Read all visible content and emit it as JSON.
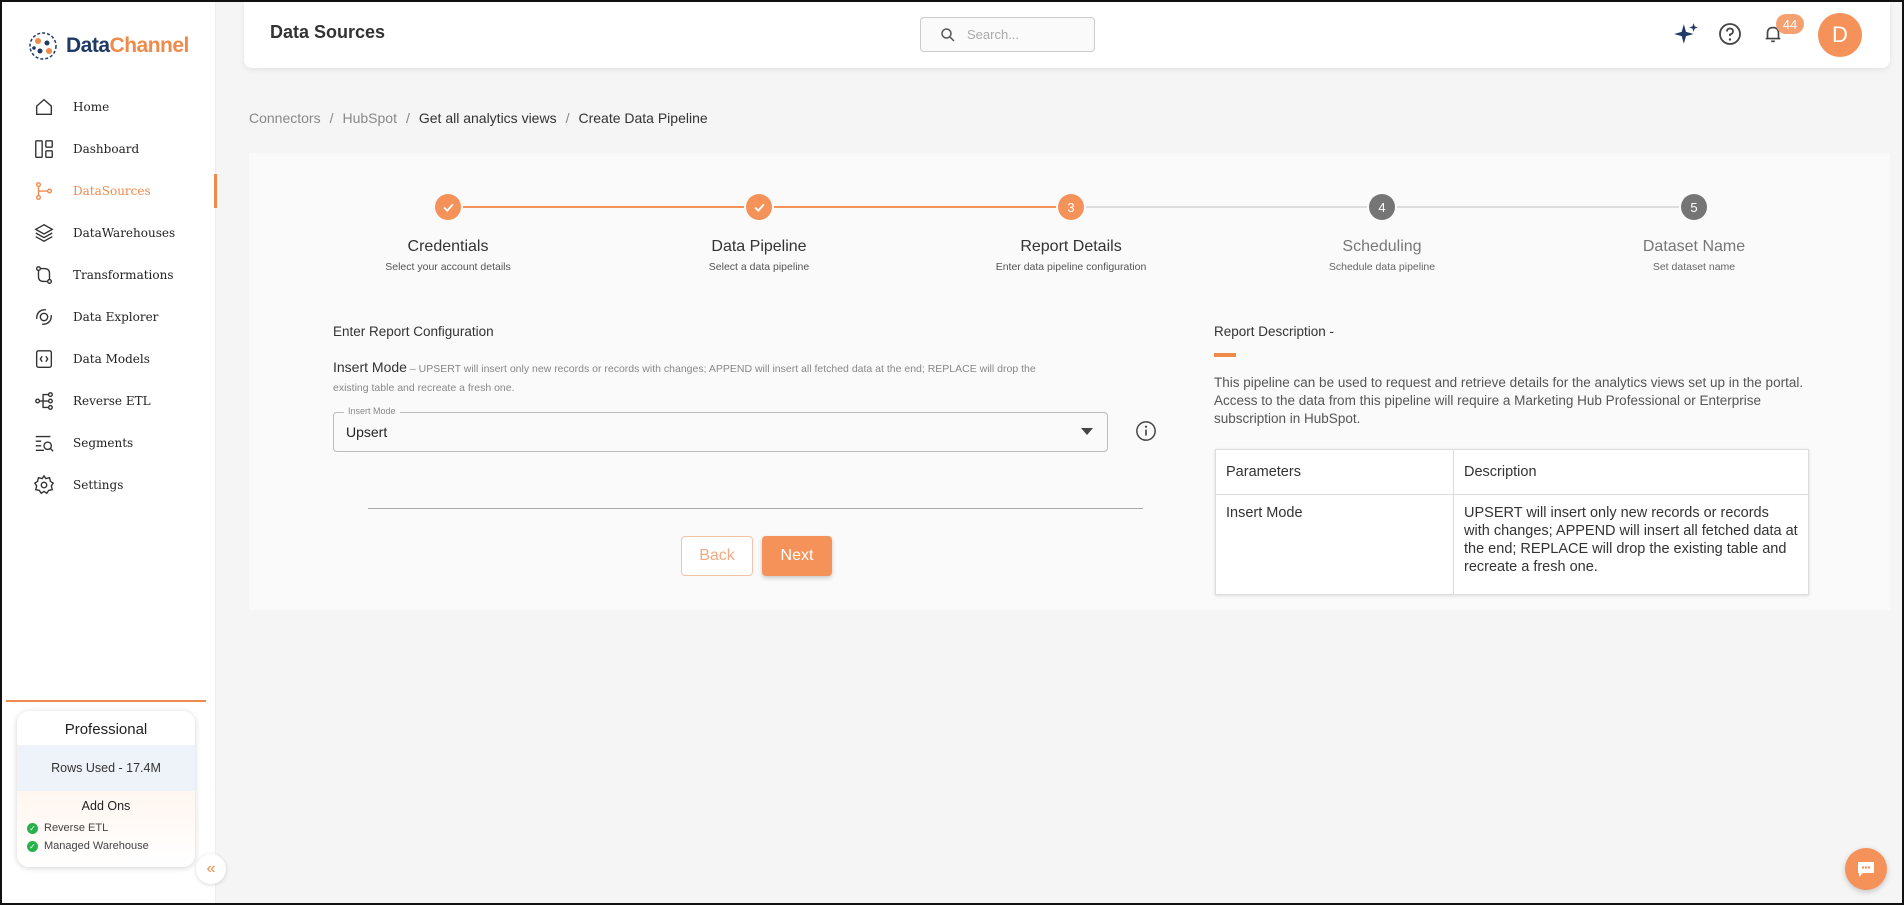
{
  "brand": {
    "name_part1": "Data",
    "name_part2": "Channel",
    "accent": "#f08a4b",
    "navy": "#1f3a64"
  },
  "sidebar": {
    "items": [
      {
        "label": "Home",
        "icon": "home-icon",
        "active": false
      },
      {
        "label": "Dashboard",
        "icon": "dashboard-icon",
        "active": false
      },
      {
        "label": "DataSources",
        "icon": "datasources-icon",
        "active": true
      },
      {
        "label": "DataWarehouses",
        "icon": "datawarehouses-icon",
        "active": false
      },
      {
        "label": "Transformations",
        "icon": "transformations-icon",
        "active": false
      },
      {
        "label": "Data Explorer",
        "icon": "data-explorer-icon",
        "active": false
      },
      {
        "label": "Data Models",
        "icon": "data-models-icon",
        "active": false
      },
      {
        "label": "Reverse ETL",
        "icon": "reverse-etl-icon",
        "active": false
      },
      {
        "label": "Segments",
        "icon": "segments-icon",
        "active": false
      },
      {
        "label": "Settings",
        "icon": "settings-icon",
        "active": false
      }
    ],
    "plan": {
      "name": "Professional",
      "rows_used": "Rows Used - 17.4M",
      "addons_title": "Add Ons",
      "addons": [
        "Reverse ETL",
        "Managed Warehouse"
      ]
    },
    "collapse_glyph": "«"
  },
  "header": {
    "title": "Data Sources",
    "search_placeholder": "Search...",
    "notification_count": "44",
    "avatar_initial": "D"
  },
  "breadcrumb": {
    "items": [
      "Connectors",
      "HubSpot",
      "Get all analytics views",
      "Create Data Pipeline"
    ],
    "separator": "/"
  },
  "stepper": {
    "steps": [
      {
        "number": "1",
        "title": "Credentials",
        "subtitle": "Select your account details",
        "state": "done"
      },
      {
        "number": "2",
        "title": "Data Pipeline",
        "subtitle": "Select a data pipeline",
        "state": "done"
      },
      {
        "number": "3",
        "title": "Report Details",
        "subtitle": "Enter data pipeline configuration",
        "state": "current"
      },
      {
        "number": "4",
        "title": "Scheduling",
        "subtitle": "Schedule data pipeline",
        "state": "todo"
      },
      {
        "number": "5",
        "title": "Dataset Name",
        "subtitle": "Set dataset name",
        "state": "todo"
      }
    ],
    "colors": {
      "done": "#f5925a",
      "current": "#f5925a",
      "todo": "#757575",
      "line_done": "#f5925a",
      "line_todo": "#dddddd",
      "title_done": "#333333",
      "title_todo": "#777777",
      "sub_done": "#555555",
      "sub_todo": "#666666"
    }
  },
  "form": {
    "section_title": "Enter Report Configuration",
    "insert_mode_label": "Insert Mode",
    "insert_mode_desc": " – UPSERT will insert only new records or records with changes; APPEND will insert all fetched data at the end; REPLACE will drop the existing table and recreate a fresh one.",
    "select_legend": "Insert Mode",
    "select_value": "Upsert",
    "back_label": "Back",
    "next_label": "Next"
  },
  "description": {
    "title": "Report Description -",
    "text": "This pipeline can be used to request and retrieve details for the analytics views set up in the portal. Access to the data from this pipeline will require a Marketing Hub Professional or Enterprise subscription in HubSpot.",
    "table": {
      "headers": [
        "Parameters",
        "Description"
      ],
      "rows": [
        [
          "Insert Mode",
          "UPSERT will insert only new records or records with changes; APPEND will insert all fetched data at the end; REPLACE will drop the existing table and recreate a fresh one."
        ]
      ]
    }
  }
}
